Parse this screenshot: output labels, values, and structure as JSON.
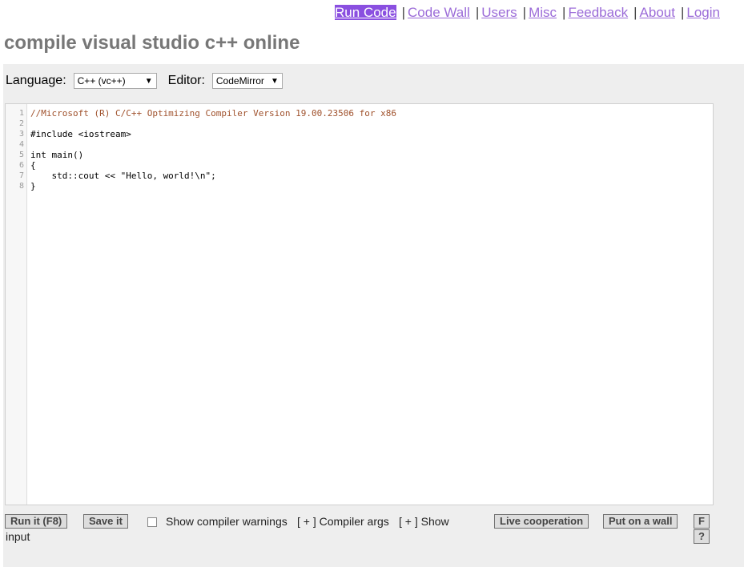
{
  "nav": {
    "items": [
      {
        "label": "Run Code",
        "active": true
      },
      {
        "label": "Code Wall"
      },
      {
        "label": "Users"
      },
      {
        "label": "Misc"
      },
      {
        "label": "Feedback"
      },
      {
        "label": "About"
      },
      {
        "label": "Login"
      }
    ],
    "separator": "|"
  },
  "title": "compile visual studio c++ online",
  "toolbar": {
    "language_label": "Language:",
    "language_value": "C++ (vc++)",
    "editor_label": "Editor:",
    "editor_value": "CodeMirror"
  },
  "editor": {
    "line_numbers": [
      "1",
      "2",
      "3",
      "4",
      "5",
      "6",
      "7",
      "8"
    ],
    "lines": [
      "//Microsoft (R) C/C++ Optimizing Compiler Version 19.00.23506 for x86",
      "",
      "#include <iostream>",
      "",
      "int main()",
      "{",
      "    std::cout << \"Hello, world!\\n\";",
      "}"
    ]
  },
  "bottom": {
    "run_label": "Run it (F8)",
    "save_label": "Save it",
    "warnings_label": "Show compiler warnings",
    "compiler_args_label": "[ + ] Compiler args",
    "show_input_label_a": "[ + ] Show",
    "show_input_label_b": "input",
    "live_coop_label": "Live cooperation",
    "wall_label": "Put on a wall",
    "f_label": "F",
    "help_label": "?"
  },
  "colors": {
    "link": "#9b6bd8",
    "active_link_bg": "#8a4fe0",
    "title": "#777777",
    "panel_bg": "#eeeeee"
  }
}
